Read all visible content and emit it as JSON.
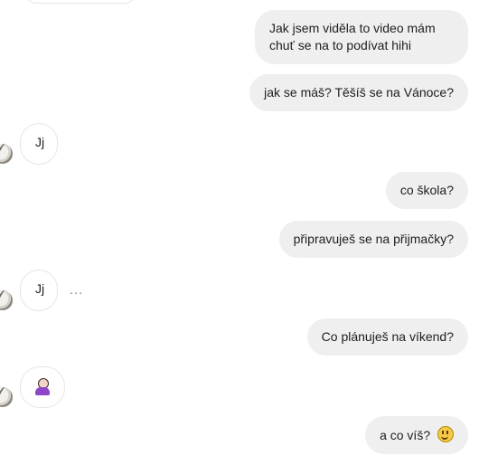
{
  "messages": [
    {
      "text": "Jak jsem viděla to video mám chuť se na to podívat hihi"
    },
    {
      "text": "jak se máš? Těšíš se na Vánoce?"
    },
    {
      "text": "Jj"
    },
    {
      "text": "co škola?"
    },
    {
      "text": "připravuješ se na přijmačky?"
    },
    {
      "text": "Jj"
    },
    {
      "text": "Co plánuješ na víkend?"
    },
    {
      "text": "a co víš?"
    }
  ],
  "icons": {
    "typing": "more-icon",
    "reaction_emoji": "woman-shrugging-emoji-icon",
    "smile_emoji": "smiling-face-emoji-icon",
    "avatar": "avatar-icon"
  },
  "colors": {
    "outgoing_bubble": "#efefef",
    "incoming_border": "#e6e6e6"
  },
  "typing_indicator": "…"
}
